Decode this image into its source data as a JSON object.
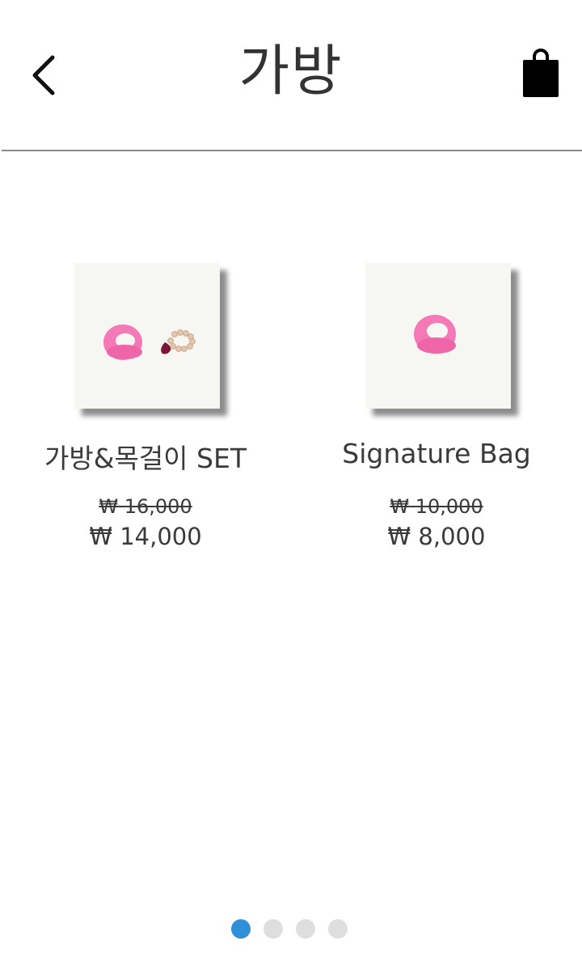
{
  "header": {
    "title": "가방",
    "back_icon": "chevron-left-icon",
    "cart_icon": "shopping-bag-icon"
  },
  "products": [
    {
      "name": "가방&목걸이 SET",
      "original_price": "₩ 16,000",
      "sale_price": "₩ 14,000",
      "image": "pink-fluffy-bag-and-pearl-necklace"
    },
    {
      "name": "Signature Bag",
      "original_price": "₩ 10,000",
      "sale_price": "₩ 8,000",
      "image": "pink-fluffy-bag"
    }
  ],
  "pager": {
    "total": 4,
    "active": 1
  },
  "colors": {
    "accent": "#2f8fd8",
    "text": "#333333",
    "pink": "#f37ab6",
    "inactive_dot": "#dedede"
  }
}
